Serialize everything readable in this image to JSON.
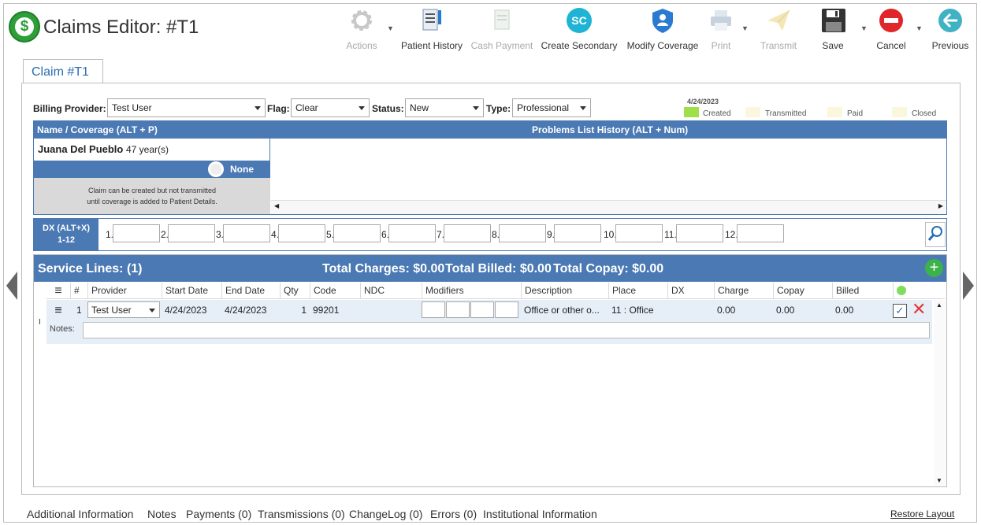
{
  "window": {
    "title": "Claims Editor: #T1"
  },
  "toolbar": {
    "actions": "Actions",
    "patient_history": "Patient History",
    "cash_payment": "Cash Payment",
    "create_secondary": "Create Secondary",
    "create_secondary_badge": "SC",
    "modify_coverage": "Modify Coverage",
    "print": "Print",
    "transmit": "Transmit",
    "save": "Save",
    "cancel": "Cancel",
    "previous": "Previous"
  },
  "claim_tab": "Claim #T1",
  "filters": {
    "billing_provider_label": "Billing Provider:",
    "billing_provider": "Test User",
    "flag_label": "Flag:",
    "flag": "Clear",
    "status_label": "Status:",
    "status": "New",
    "type_label": "Type:",
    "type": "Professional"
  },
  "legend": {
    "date": "4/24/2023",
    "created": "Created",
    "transmitted": "Transmitted",
    "paid": "Paid",
    "closed": "Closed",
    "created_color": "#9fe04a",
    "other_color": "#fbf7de"
  },
  "coverage": {
    "header": "Name / Coverage (ALT + P)",
    "problems_header": "Problems List History (ALT + Num)",
    "patient_name": "Juana Del Pueblo",
    "patient_age": "47 year(s)",
    "coverage": "None",
    "note_line1": "Claim can be created but not transmitted",
    "note_line2": "until coverage is added to Patient Details."
  },
  "dx": {
    "label1": "DX (ALT+X)",
    "label2": "1-12",
    "numbers": [
      "1.",
      "2.",
      "3.",
      "4.",
      "5.",
      "6.",
      "7.",
      "8.",
      "9.",
      "10.",
      "11.",
      "12."
    ]
  },
  "service": {
    "title": "Service Lines: (1)",
    "total_charges": "Total Charges: $0.00",
    "total_billed": "Total Billed: $0.00",
    "total_copay": "Total Copay: $0.00",
    "columns": [
      "#",
      "Provider",
      "Start Date",
      "End Date",
      "Qty",
      "Code",
      "NDC",
      "Modifiers",
      "Description",
      "Place",
      "DX",
      "Charge",
      "Copay",
      "Billed"
    ],
    "row": {
      "num": "1",
      "provider": "Test User",
      "start": "4/24/2023",
      "end": "4/24/2023",
      "qty": "1",
      "code": "99201",
      "ndc": "",
      "description": "Office or other o...",
      "place": "11 : Office",
      "dx": "",
      "charge": "0.00",
      "copay": "0.00",
      "billed": "0.00"
    },
    "notes_label": "Notes:"
  },
  "footer": {
    "tabs": [
      "Additional Information",
      "Notes",
      "Payments (0)",
      "Transmissions (0)",
      "ChangeLog (0)",
      "Errors (0)",
      "Institutional Information"
    ],
    "restore": "Restore Layout"
  }
}
